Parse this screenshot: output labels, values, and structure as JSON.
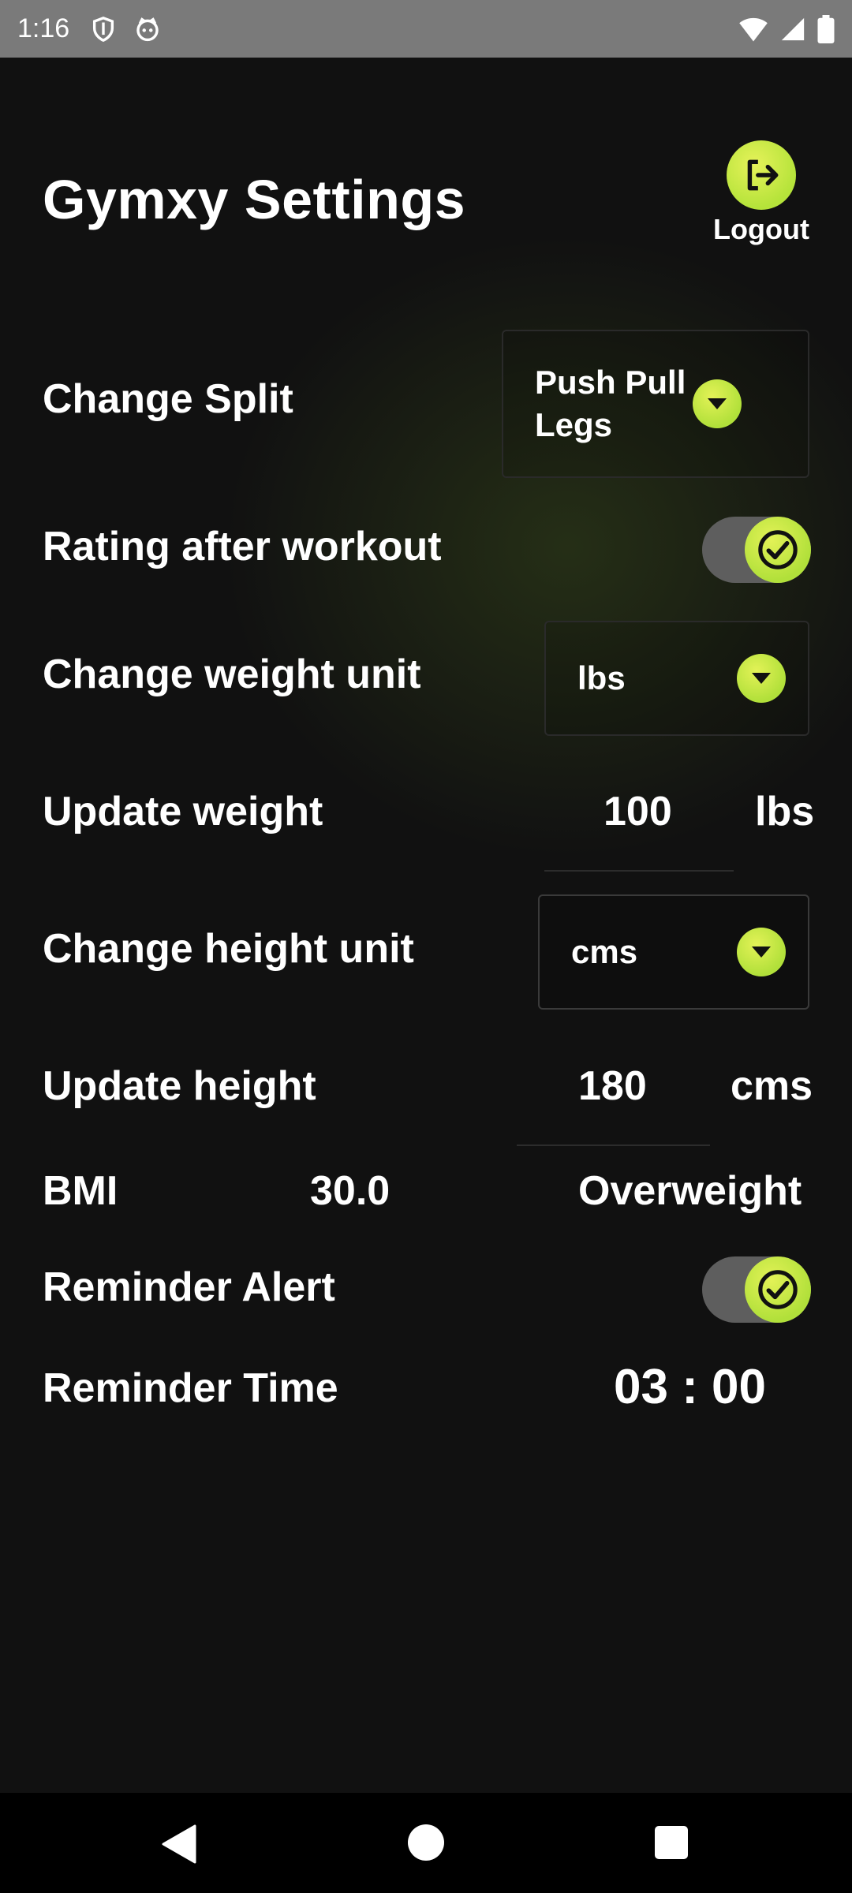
{
  "status_bar": {
    "time": "1:16",
    "icons": [
      "shield-icon",
      "cat-face-icon",
      "wifi-icon",
      "signal-icon",
      "battery-icon"
    ]
  },
  "header": {
    "title": "Gymxy Settings",
    "logout_label": "Logout"
  },
  "settings": {
    "change_split": {
      "label": "Change Split",
      "value": "Push Pull Legs"
    },
    "rating_after_workout": {
      "label": "Rating after workout",
      "enabled": true
    },
    "change_weight_unit": {
      "label": "Change weight unit",
      "value": "lbs"
    },
    "update_weight": {
      "label": "Update weight",
      "value": "100",
      "unit": "lbs"
    },
    "change_height_unit": {
      "label": "Change height unit",
      "value": "cms"
    },
    "update_height": {
      "label": "Update height",
      "value": "180",
      "unit": "cms"
    },
    "bmi": {
      "label": "BMI",
      "value": "30.0",
      "category": "Overweight"
    },
    "reminder_alert": {
      "label": "Reminder Alert",
      "enabled": true
    },
    "reminder_time": {
      "label": "Reminder Time",
      "value": "03 : 00"
    }
  },
  "colors": {
    "accent": "#c7ea45",
    "background": "#111111",
    "toggle_track": "#5e5e5e",
    "status_bar": "#7a7a7a"
  }
}
